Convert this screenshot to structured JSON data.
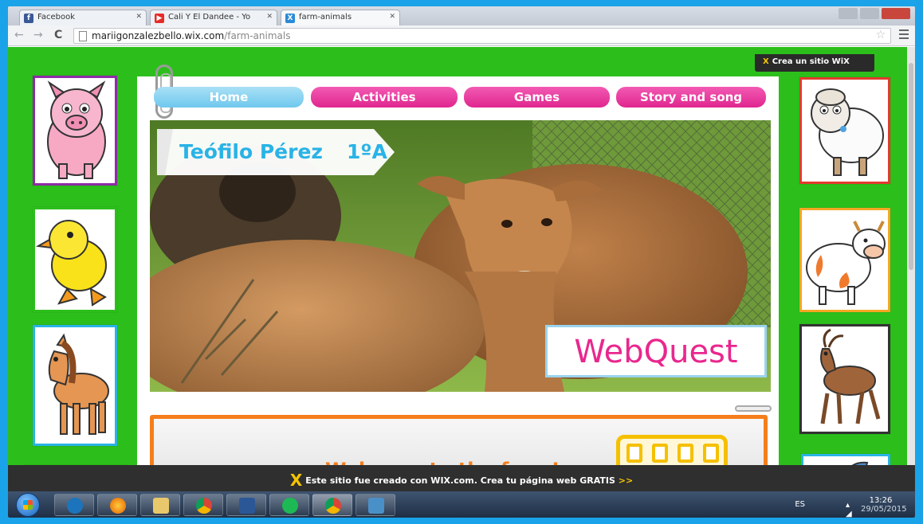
{
  "browser": {
    "tabs": [
      {
        "label": "Facebook",
        "icon": "facebook-icon",
        "color": "#3b5998",
        "glyph": "f"
      },
      {
        "label": "Cali Y El Dandee - Yo",
        "icon": "youtube-icon",
        "color": "#e52d27",
        "glyph": "▶"
      },
      {
        "label": "farm-animals",
        "icon": "wix-icon",
        "color": "#2a8ad8",
        "glyph": "X"
      }
    ],
    "url_host": "mariigonzalezbello.wix.com",
    "url_path": "/farm-animals"
  },
  "wix_badge": "Crea un sitio WiX",
  "nav": {
    "home": "Home",
    "activities": "Activities",
    "games": "Games",
    "story": "Story and song"
  },
  "banner": {
    "name": "Teófilo Pérez",
    "class": "1ºA"
  },
  "webquest_label": "WebQuest",
  "welcome_text": "Welcome to the farm!",
  "wix_bar": {
    "text": "Este sitio fue creado con WIX.com. Crea tu página web GRATIS",
    "cta": ">>"
  },
  "taskbar": {
    "language": "ES",
    "time": "13:26",
    "date": "29/05/2015",
    "apps": [
      "hp-icon",
      "firefox-icon",
      "explorer-icon",
      "chrome-icon",
      "word-icon",
      "spotify-icon",
      "chrome-icon",
      "photos-icon"
    ]
  },
  "colors": {
    "page_green": "#2cbf1b",
    "pink": "#e0268f",
    "light_blue": "#6ec8ee",
    "orange": "#f57e1c"
  }
}
